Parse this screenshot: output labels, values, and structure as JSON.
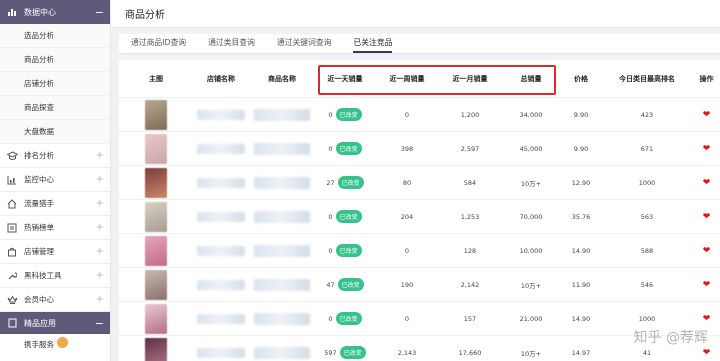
{
  "sidebar": {
    "section1": {
      "label": "数据中心",
      "toggle": "−"
    },
    "subitems": [
      "选品分析",
      "商品分析",
      "店铺分析",
      "商品探查",
      "大盘数据"
    ],
    "items": [
      {
        "label": "排名分析",
        "icon": "graduation-cap-icon"
      },
      {
        "label": "监控中心",
        "icon": "chart-icon"
      },
      {
        "label": "流量猎手",
        "icon": "home-icon"
      },
      {
        "label": "热销榜单",
        "icon": "list-icon"
      },
      {
        "label": "店铺管理",
        "icon": "bag-icon"
      },
      {
        "label": "黑科技工具",
        "icon": "wrench-icon"
      },
      {
        "label": "会员中心",
        "icon": "crown-icon"
      }
    ],
    "section2": {
      "label": "精品应用",
      "toggle": "−"
    },
    "last_item": "携手服务"
  },
  "topbar": {
    "title": "商品分析"
  },
  "tabs": [
    "通过商品ID查询",
    "通过类目查询",
    "通过关键词查询",
    "已关注竞品"
  ],
  "active_tab": 3,
  "table": {
    "headers": [
      "主图",
      "店铺名称",
      "商品名称",
      "近一天销量",
      "近一周销量",
      "近一月销量",
      "总销量",
      "价格",
      "今日类目最高排名",
      "操作"
    ],
    "tag_label": "已改变",
    "rows": [
      {
        "day": "0",
        "week": "0",
        "month": "1,200",
        "total": "34,000",
        "price": "9.90",
        "rank": "423"
      },
      {
        "day": "0",
        "week": "398",
        "month": "2,597",
        "total": "45,000",
        "price": "9.90",
        "rank": "671"
      },
      {
        "day": "27",
        "week": "80",
        "month": "584",
        "total": "10万+",
        "price": "12.90",
        "rank": "1000"
      },
      {
        "day": "0",
        "week": "204",
        "month": "1,253",
        "total": "70,000",
        "price": "35.76",
        "rank": "563"
      },
      {
        "day": "0",
        "week": "0",
        "month": "128",
        "total": "10,000",
        "price": "14.90",
        "rank": "588"
      },
      {
        "day": "47",
        "week": "190",
        "month": "2,142",
        "total": "10万+",
        "price": "11.90",
        "rank": "546"
      },
      {
        "day": "0",
        "week": "0",
        "month": "157",
        "total": "21,000",
        "price": "14.90",
        "rank": "1000"
      },
      {
        "day": "597",
        "week": "2,143",
        "month": "17,660",
        "total": "10万+",
        "price": "14.97",
        "rank": "41"
      }
    ]
  },
  "watermark": "知乎 @荐辉",
  "colors": {
    "sidebar_head": "#5f5a7a",
    "tag": "#35c38b",
    "heart": "#e0141e",
    "highlight": "#d62b2b"
  }
}
